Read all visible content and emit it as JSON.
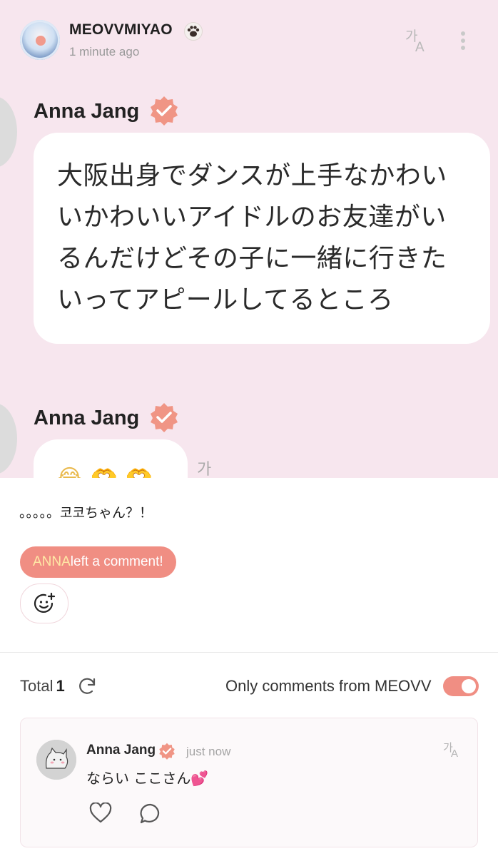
{
  "header": {
    "username": "MEOVVMIYAO",
    "username_emoji": "🐾",
    "time": "1 minute ago",
    "translate_icon": "translate-icon",
    "more_icon": "more-icon"
  },
  "chat": {
    "messages": [
      {
        "sender": "Anna Jang",
        "text": "大阪出身でダンスが上手なかわいいかわいいアイドルのお友達がいるんだけどその子に一緒に行きたいってアピールしてるところ"
      },
      {
        "sender": "Anna Jang",
        "text": "😂🫶🫶"
      }
    ]
  },
  "post": {
    "text": "。。。。。코코ちゃん？！",
    "notice_highlight": "ANNA",
    "notice_rest": "left a comment!",
    "reaction_icon": "add-reaction-icon"
  },
  "comments": {
    "total_label": "Total",
    "total_count": "1",
    "filter_label": "Only comments from MEOVV",
    "filter_on": true,
    "accent_color": "#f08e83",
    "items": [
      {
        "author": "Anna Jang",
        "time": "just now",
        "text": "ならい ここさん💕"
      }
    ]
  }
}
